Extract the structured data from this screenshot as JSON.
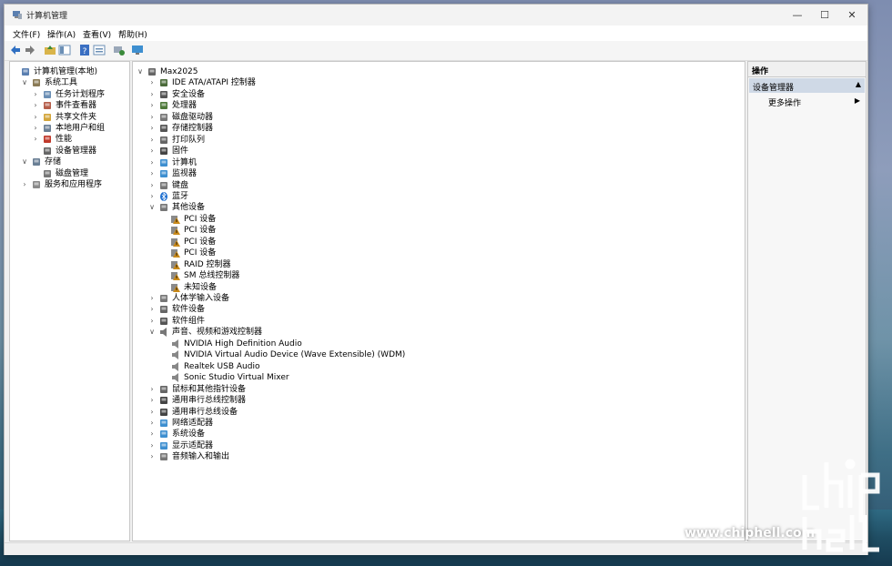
{
  "window": {
    "title": "计算机管理"
  },
  "menu": [
    "文件(F)",
    "操作(A)",
    "查看(V)",
    "帮助(H)"
  ],
  "left_tree": [
    {
      "label": "计算机管理(本地)",
      "indent": 0,
      "chev": "",
      "icon": "computer-management-icon",
      "color": "#5a7fb0"
    },
    {
      "label": "系统工具",
      "indent": 1,
      "chev": "∨",
      "icon": "tools-icon",
      "color": "#8a7a55"
    },
    {
      "label": "任务计划程序",
      "indent": 2,
      "chev": "›",
      "icon": "clock-icon",
      "color": "#6b8fb5"
    },
    {
      "label": "事件查看器",
      "indent": 2,
      "chev": "›",
      "icon": "event-viewer-icon",
      "color": "#b55e4a"
    },
    {
      "label": "共享文件夹",
      "indent": 2,
      "chev": "›",
      "icon": "shared-folder-icon",
      "color": "#d3a53a"
    },
    {
      "label": "本地用户和组",
      "indent": 2,
      "chev": "›",
      "icon": "users-icon",
      "color": "#6a7f95"
    },
    {
      "label": "性能",
      "indent": 2,
      "chev": "›",
      "icon": "performance-icon",
      "color": "#c0392b"
    },
    {
      "label": "设备管理器",
      "indent": 2,
      "chev": "",
      "icon": "device-manager-icon",
      "color": "#666",
      "selected": true
    },
    {
      "label": "存储",
      "indent": 1,
      "chev": "∨",
      "icon": "storage-icon",
      "color": "#6a7f95"
    },
    {
      "label": "磁盘管理",
      "indent": 2,
      "chev": "",
      "icon": "disk-management-icon",
      "color": "#777"
    },
    {
      "label": "服务和应用程序",
      "indent": 1,
      "chev": "›",
      "icon": "services-icon",
      "color": "#8a8a8a"
    }
  ],
  "device_tree": [
    {
      "label": "Max2025",
      "indent": 0,
      "chev": "∨",
      "icon": "computer-icon",
      "color": "#666"
    },
    {
      "label": "IDE ATA/ATAPI 控制器",
      "indent": 1,
      "chev": "›",
      "icon": "ide-controller-icon",
      "color": "#4b6b3a"
    },
    {
      "label": "安全设备",
      "indent": 1,
      "chev": "›",
      "icon": "security-device-icon",
      "color": "#555"
    },
    {
      "label": "处理器",
      "indent": 1,
      "chev": "›",
      "icon": "processor-icon",
      "color": "#4f7a3a"
    },
    {
      "label": "磁盘驱动器",
      "indent": 1,
      "chev": "›",
      "icon": "disk-drive-icon",
      "color": "#777"
    },
    {
      "label": "存储控制器",
      "indent": 1,
      "chev": "›",
      "icon": "storage-controller-icon",
      "color": "#555"
    },
    {
      "label": "打印队列",
      "indent": 1,
      "chev": "›",
      "icon": "printer-icon",
      "color": "#666"
    },
    {
      "label": "固件",
      "indent": 1,
      "chev": "›",
      "icon": "firmware-icon",
      "color": "#444"
    },
    {
      "label": "计算机",
      "indent": 1,
      "chev": "›",
      "icon": "computer-icon",
      "color": "#3e8fd0"
    },
    {
      "label": "监视器",
      "indent": 1,
      "chev": "›",
      "icon": "monitor-icon",
      "color": "#3e8fd0"
    },
    {
      "label": "键盘",
      "indent": 1,
      "chev": "›",
      "icon": "keyboard-icon",
      "color": "#777"
    },
    {
      "label": "蓝牙",
      "indent": 1,
      "chev": "›",
      "icon": "bluetooth-icon",
      "color": "#1e6fd0"
    },
    {
      "label": "其他设备",
      "indent": 1,
      "chev": "∨",
      "icon": "other-devices-icon",
      "color": "#777"
    },
    {
      "label": "PCI 设备",
      "indent": 2,
      "chev": "",
      "icon": "warning-device-icon",
      "color": "#c98a1a"
    },
    {
      "label": "PCI 设备",
      "indent": 2,
      "chev": "",
      "icon": "warning-device-icon",
      "color": "#c98a1a"
    },
    {
      "label": "PCI 设备",
      "indent": 2,
      "chev": "",
      "icon": "warning-device-icon",
      "color": "#c98a1a"
    },
    {
      "label": "PCI 设备",
      "indent": 2,
      "chev": "",
      "icon": "warning-device-icon",
      "color": "#c98a1a"
    },
    {
      "label": "RAID 控制器",
      "indent": 2,
      "chev": "",
      "icon": "warning-device-icon",
      "color": "#c98a1a"
    },
    {
      "label": "SM 总线控制器",
      "indent": 2,
      "chev": "",
      "icon": "warning-device-icon",
      "color": "#c98a1a"
    },
    {
      "label": "未知设备",
      "indent": 2,
      "chev": "",
      "icon": "warning-device-icon",
      "color": "#c98a1a"
    },
    {
      "label": "人体学输入设备",
      "indent": 1,
      "chev": "›",
      "icon": "hid-icon",
      "color": "#777"
    },
    {
      "label": "软件设备",
      "indent": 1,
      "chev": "›",
      "icon": "software-device-icon",
      "color": "#666"
    },
    {
      "label": "软件组件",
      "indent": 1,
      "chev": "›",
      "icon": "software-component-icon",
      "color": "#555"
    },
    {
      "label": "声音、视频和游戏控制器",
      "indent": 1,
      "chev": "∨",
      "icon": "speaker-icon",
      "color": "#777"
    },
    {
      "label": "NVIDIA High Definition Audio",
      "indent": 2,
      "chev": "",
      "icon": "speaker-icon",
      "color": "#888"
    },
    {
      "label": "NVIDIA Virtual Audio Device (Wave Extensible) (WDM)",
      "indent": 2,
      "chev": "",
      "icon": "speaker-icon",
      "color": "#888"
    },
    {
      "label": "Realtek USB Audio",
      "indent": 2,
      "chev": "",
      "icon": "speaker-icon",
      "color": "#888"
    },
    {
      "label": "Sonic Studio Virtual Mixer",
      "indent": 2,
      "chev": "",
      "icon": "speaker-icon",
      "color": "#888"
    },
    {
      "label": "鼠标和其他指针设备",
      "indent": 1,
      "chev": "›",
      "icon": "mouse-icon",
      "color": "#666"
    },
    {
      "label": "通用串行总线控制器",
      "indent": 1,
      "chev": "›",
      "icon": "usb-icon",
      "color": "#444"
    },
    {
      "label": "通用串行总线设备",
      "indent": 1,
      "chev": "›",
      "icon": "usb-icon",
      "color": "#444"
    },
    {
      "label": "网络适配器",
      "indent": 1,
      "chev": "›",
      "icon": "network-adapter-icon",
      "color": "#3e8fd0"
    },
    {
      "label": "系统设备",
      "indent": 1,
      "chev": "›",
      "icon": "system-device-icon",
      "color": "#3e8fd0"
    },
    {
      "label": "显示适配器",
      "indent": 1,
      "chev": "›",
      "icon": "display-adapter-icon",
      "color": "#3e8fd0"
    },
    {
      "label": "音频输入和输出",
      "indent": 1,
      "chev": "›",
      "icon": "audio-io-icon",
      "color": "#777"
    }
  ],
  "actions": {
    "header": "操作",
    "section": "设备管理器",
    "item": "更多操作"
  },
  "watermark": {
    "url": "www.chiphell.com",
    "logo_text": "chip hell"
  }
}
